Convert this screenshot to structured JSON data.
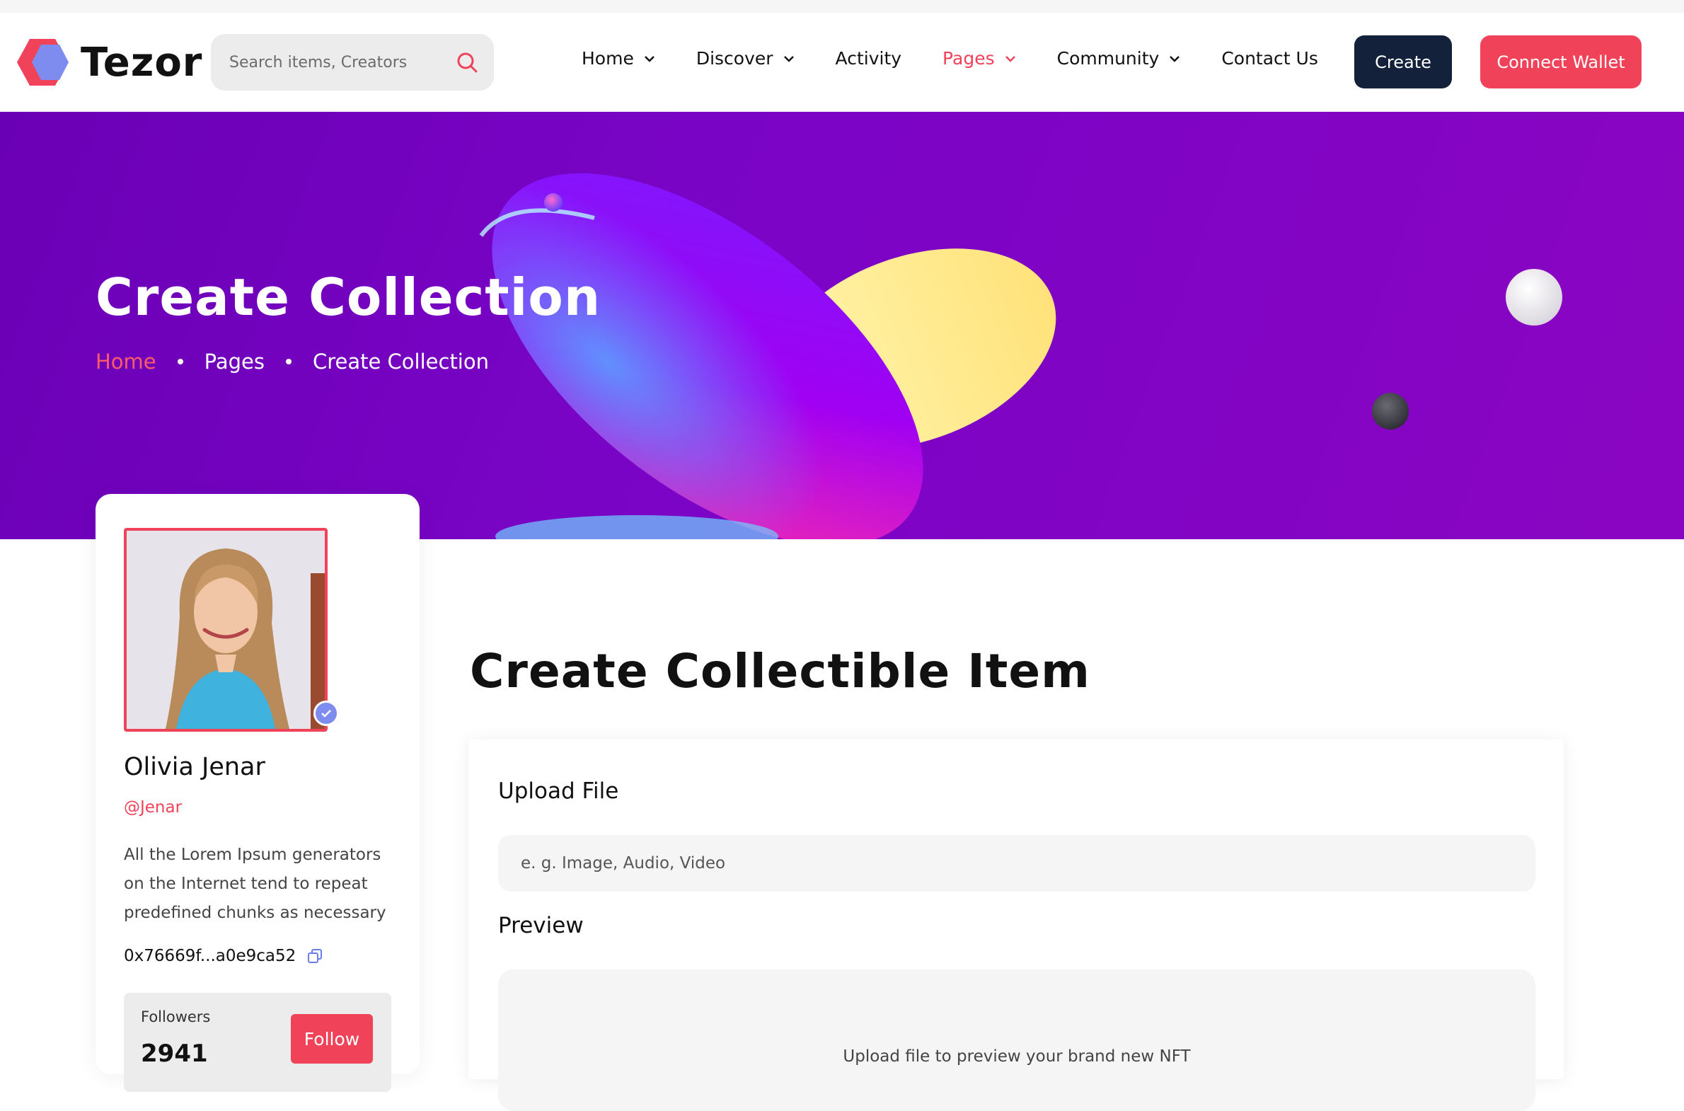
{
  "brand": {
    "name": "Tezor"
  },
  "search": {
    "placeholder": "Search items, Creators"
  },
  "nav": {
    "items": [
      {
        "label": "Home",
        "dropdown": true,
        "active": false
      },
      {
        "label": "Discover",
        "dropdown": true,
        "active": false
      },
      {
        "label": "Activity",
        "dropdown": false,
        "active": false
      },
      {
        "label": "Pages",
        "dropdown": true,
        "active": true
      },
      {
        "label": "Community",
        "dropdown": true,
        "active": false
      },
      {
        "label": "Contact Us",
        "dropdown": false,
        "active": false
      }
    ],
    "create_label": "Create",
    "wallet_label": "Connect Wallet"
  },
  "hero": {
    "title": "Create Collection",
    "breadcrumb": [
      "Home",
      "Pages",
      "Create Collection"
    ]
  },
  "profile": {
    "name": "Olivia Jenar",
    "handle": "@Jenar",
    "bio": "All the Lorem Ipsum generators on the Internet tend to repeat predefined chunks as necessary",
    "wallet": "0x76669f...a0e9ca52",
    "followers_label": "Followers",
    "followers_count": "2941",
    "follow_label": "Follow"
  },
  "form": {
    "title": "Create Collectible Item",
    "upload_label": "Upload File",
    "upload_placeholder": "e. g. Image, Audio, Video",
    "preview_label": "Preview",
    "preview_hint": "Upload file to preview your brand new NFT"
  },
  "colors": {
    "accent": "#f0435a",
    "dark": "#14213a",
    "hero_bg": "#7a04c6"
  },
  "icons": {
    "search": "search-icon",
    "chevron": "chevron-down-icon",
    "verified": "verified-check-icon",
    "copy": "copy-icon"
  }
}
